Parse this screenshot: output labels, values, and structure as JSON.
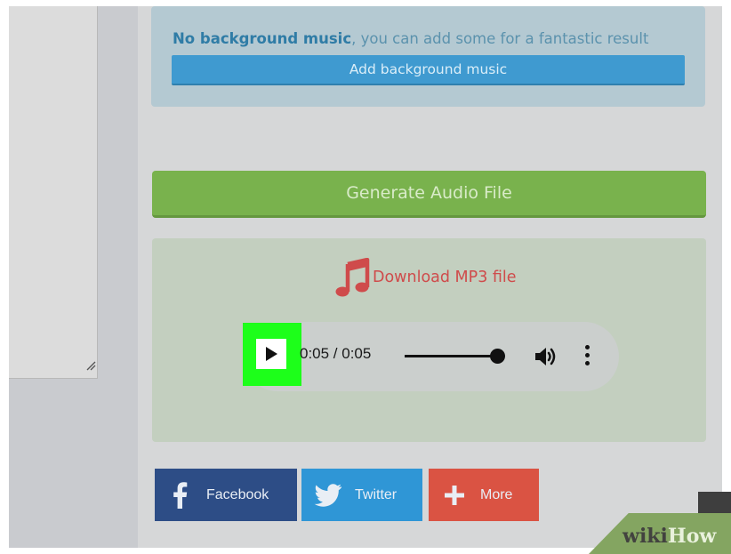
{
  "textarea": {
    "resize_icon": "resize-grip-icon"
  },
  "music": {
    "prefix": "No background music",
    "suffix": ", you can add some for a fantastic result",
    "button_label": "Add background music"
  },
  "generate": {
    "label": "Generate Audio File"
  },
  "download": {
    "label": "Download MP3 file",
    "icon": "music-note-icon"
  },
  "player": {
    "time": "0:05 / 0:05",
    "progress": 1.0,
    "play_icon": "play-icon",
    "volume_icon": "volume-icon",
    "menu_icon": "more-vertical-icon"
  },
  "share": [
    {
      "label": "Facebook",
      "icon": "facebook-icon",
      "color": "#2d4d86"
    },
    {
      "label": "Twitter",
      "icon": "twitter-icon",
      "color": "#2f96d6"
    },
    {
      "label": "More",
      "icon": "plus-icon",
      "color": "#da5343"
    }
  ],
  "watermark": {
    "part1": "wiki",
    "part2": "How"
  },
  "colors": {
    "highlight": "#1dff1a",
    "generate": "#79b24d",
    "music_button": "#3f9ad0",
    "download_text": "#cf4b4b"
  }
}
